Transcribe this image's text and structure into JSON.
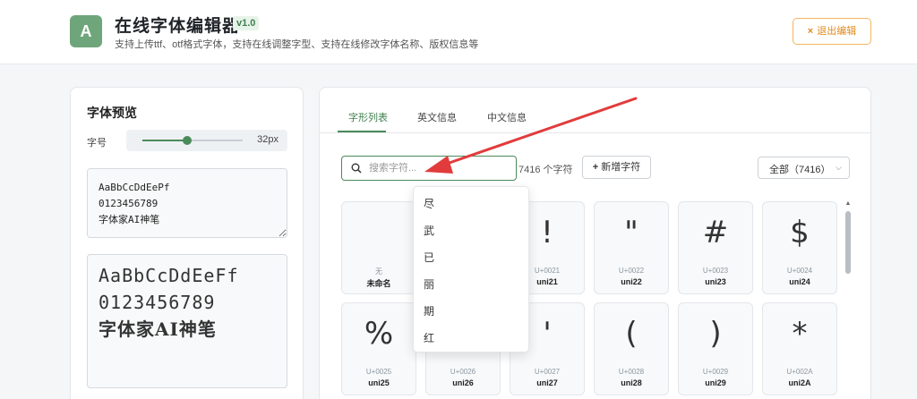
{
  "header": {
    "logo_letter": "A",
    "title": "在线字体编辑器",
    "version": "v1.0",
    "subtitle": "支持上传ttf、otf格式字体，支持在线调整字型、支持在线修改字体名称、版权信息等",
    "exit_label": "退出编辑",
    "exit_icon": "×"
  },
  "preview": {
    "title": "字体预览",
    "size_label": "字号",
    "size_value": "32px",
    "size_fraction": 0.45,
    "sample_text": "AaBbCcDdEePf\n0123456789\n字体家AI神笔",
    "rendered_lines": [
      "AaBbCcDdEeFf",
      "0123456789",
      "字体家AI神笔"
    ]
  },
  "tabs": {
    "items": [
      "字形列表",
      "英文信息",
      "中文信息"
    ],
    "active_index": 0
  },
  "toolbar": {
    "search_placeholder": "搜索字符...",
    "glyph_count": "7416 个字符",
    "add_glyph_label": "新增字符",
    "add_glyph_icon": "+",
    "filter_value": "全部（7416）"
  },
  "glyphs": [
    {
      "char": "",
      "code": "无",
      "name": "未命名"
    },
    {
      "char": "",
      "code": "",
      "name": ""
    },
    {
      "char": "!",
      "code": "U+0021",
      "name": "uni21"
    },
    {
      "char": "\"",
      "code": "U+0022",
      "name": "uni22"
    },
    {
      "char": "#",
      "code": "U+0023",
      "name": "uni23"
    },
    {
      "char": "$",
      "code": "U+0024",
      "name": "uni24"
    },
    {
      "char": "%",
      "code": "U+0025",
      "name": "uni25"
    },
    {
      "char": "&",
      "code": "U+0026",
      "name": "uni26"
    },
    {
      "char": "'",
      "code": "U+0027",
      "name": "uni27"
    },
    {
      "char": "(",
      "code": "U+0028",
      "name": "uni28"
    },
    {
      "char": ")",
      "code": "U+0029",
      "name": "uni29"
    },
    {
      "char": "*",
      "code": "U+002A",
      "name": "uni2A"
    }
  ],
  "suggestions": [
    "尽",
    "武",
    "已",
    "丽",
    "期",
    "红"
  ],
  "colors": {
    "accent": "#4b8a5a",
    "exit": "#e08a1e",
    "arrow": "#e23b3b"
  }
}
